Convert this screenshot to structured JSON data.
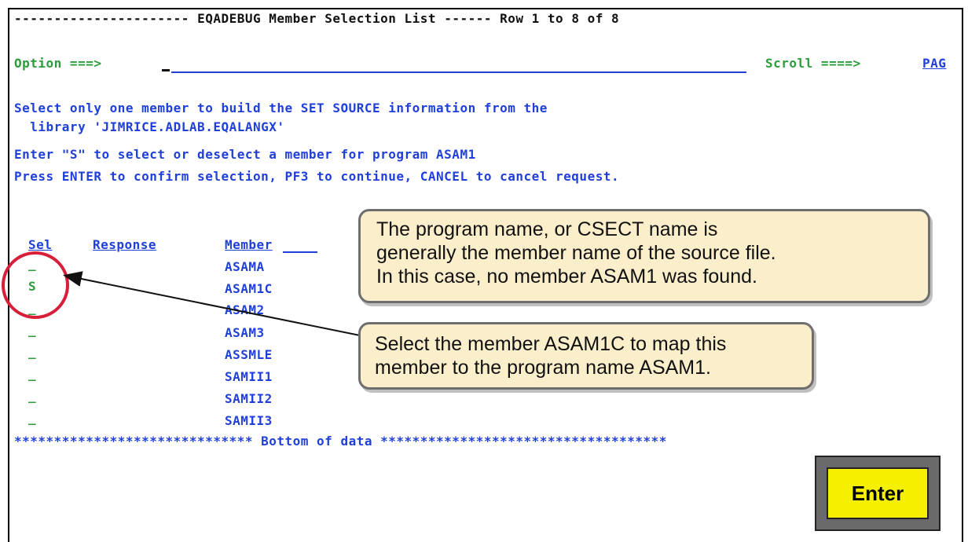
{
  "header": {
    "dashes_left": "----------------------",
    "title": "EQADEBUG Member Selection List",
    "dashes_right": "------",
    "row_info": "Row 1 to 8 of 8"
  },
  "command": {
    "option_label": "Option ===>",
    "option_value": "",
    "scroll_label": "Scroll ====>",
    "scroll_value": "PAG"
  },
  "instructions": [
    "Select only one member to build the SET SOURCE information from the",
    "  library 'JIMRICE.ADLAB.EQALANGX'",
    "Enter \"S\" to select or deselect a member for program ASAM1",
    "Press ENTER to confirm selection, PF3 to continue, CANCEL to cancel request."
  ],
  "table": {
    "headers": {
      "sel": "Sel",
      "response": "Response",
      "member": "Member"
    },
    "rows": [
      {
        "sel": "_",
        "member": "ASAMA"
      },
      {
        "sel": "S",
        "member": "ASAM1C"
      },
      {
        "sel": "_",
        "member": "ASAM2"
      },
      {
        "sel": "_",
        "member": "ASAM3"
      },
      {
        "sel": "_",
        "member": "ASSMLE"
      },
      {
        "sel": "_",
        "member": "SAMII1"
      },
      {
        "sel": "_",
        "member": "SAMII2"
      },
      {
        "sel": "_",
        "member": "SAMII3"
      }
    ]
  },
  "bottom_marker": "****************************** Bottom of data ************************************",
  "callouts": {
    "top": [
      "The program name, or CSECT name is",
      "generally the member name of the source file.",
      "In this case, no member ASAM1 was found."
    ],
    "bottom": [
      "Select the member ASAM1C to map this",
      "member to the program name ASAM1."
    ]
  },
  "enter_button": "Enter",
  "colors": {
    "terminal_green": "#2a9d3a",
    "terminal_blue": "#1f3fd8",
    "highlight_red": "#d81f3a",
    "callout_fill": "#fbeecb",
    "button_yellow": "#f5ef00"
  }
}
